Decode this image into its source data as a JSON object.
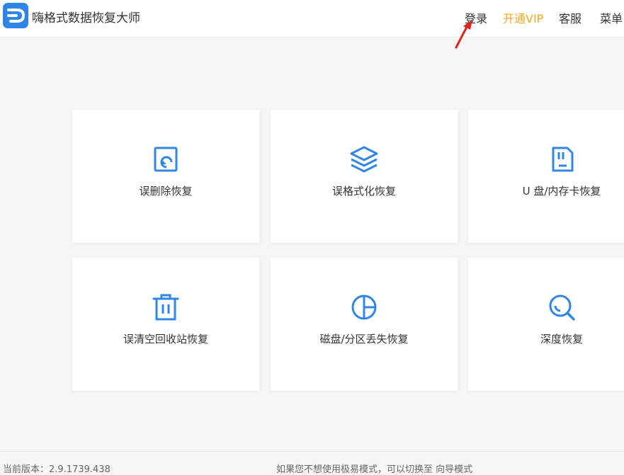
{
  "header": {
    "app_title": "嗨格式数据恢复大师",
    "nav": {
      "login": "登录",
      "vip": "开通VIP",
      "service": "客服",
      "menu": "菜单"
    }
  },
  "cards": [
    {
      "label": "误删除恢复",
      "icon": "file-restore-icon"
    },
    {
      "label": "误格式化恢复",
      "icon": "layers-icon"
    },
    {
      "label": "U 盘/内存卡恢复",
      "icon": "sd-card-icon"
    },
    {
      "label": "误清空回收站恢复",
      "icon": "trash-icon"
    },
    {
      "label": "磁盘/分区丢失恢复",
      "icon": "pie-chart-icon"
    },
    {
      "label": "深度恢复",
      "icon": "search-icon"
    }
  ],
  "footer": {
    "version": "当前版本：2.9.1739.438",
    "mode_hint": "如果您不想使用极易模式，可以切换至 向导模式"
  },
  "colors": {
    "accent": "#2f86e6",
    "vip": "#f5a623",
    "annotation_arrow": "#e0261c"
  }
}
